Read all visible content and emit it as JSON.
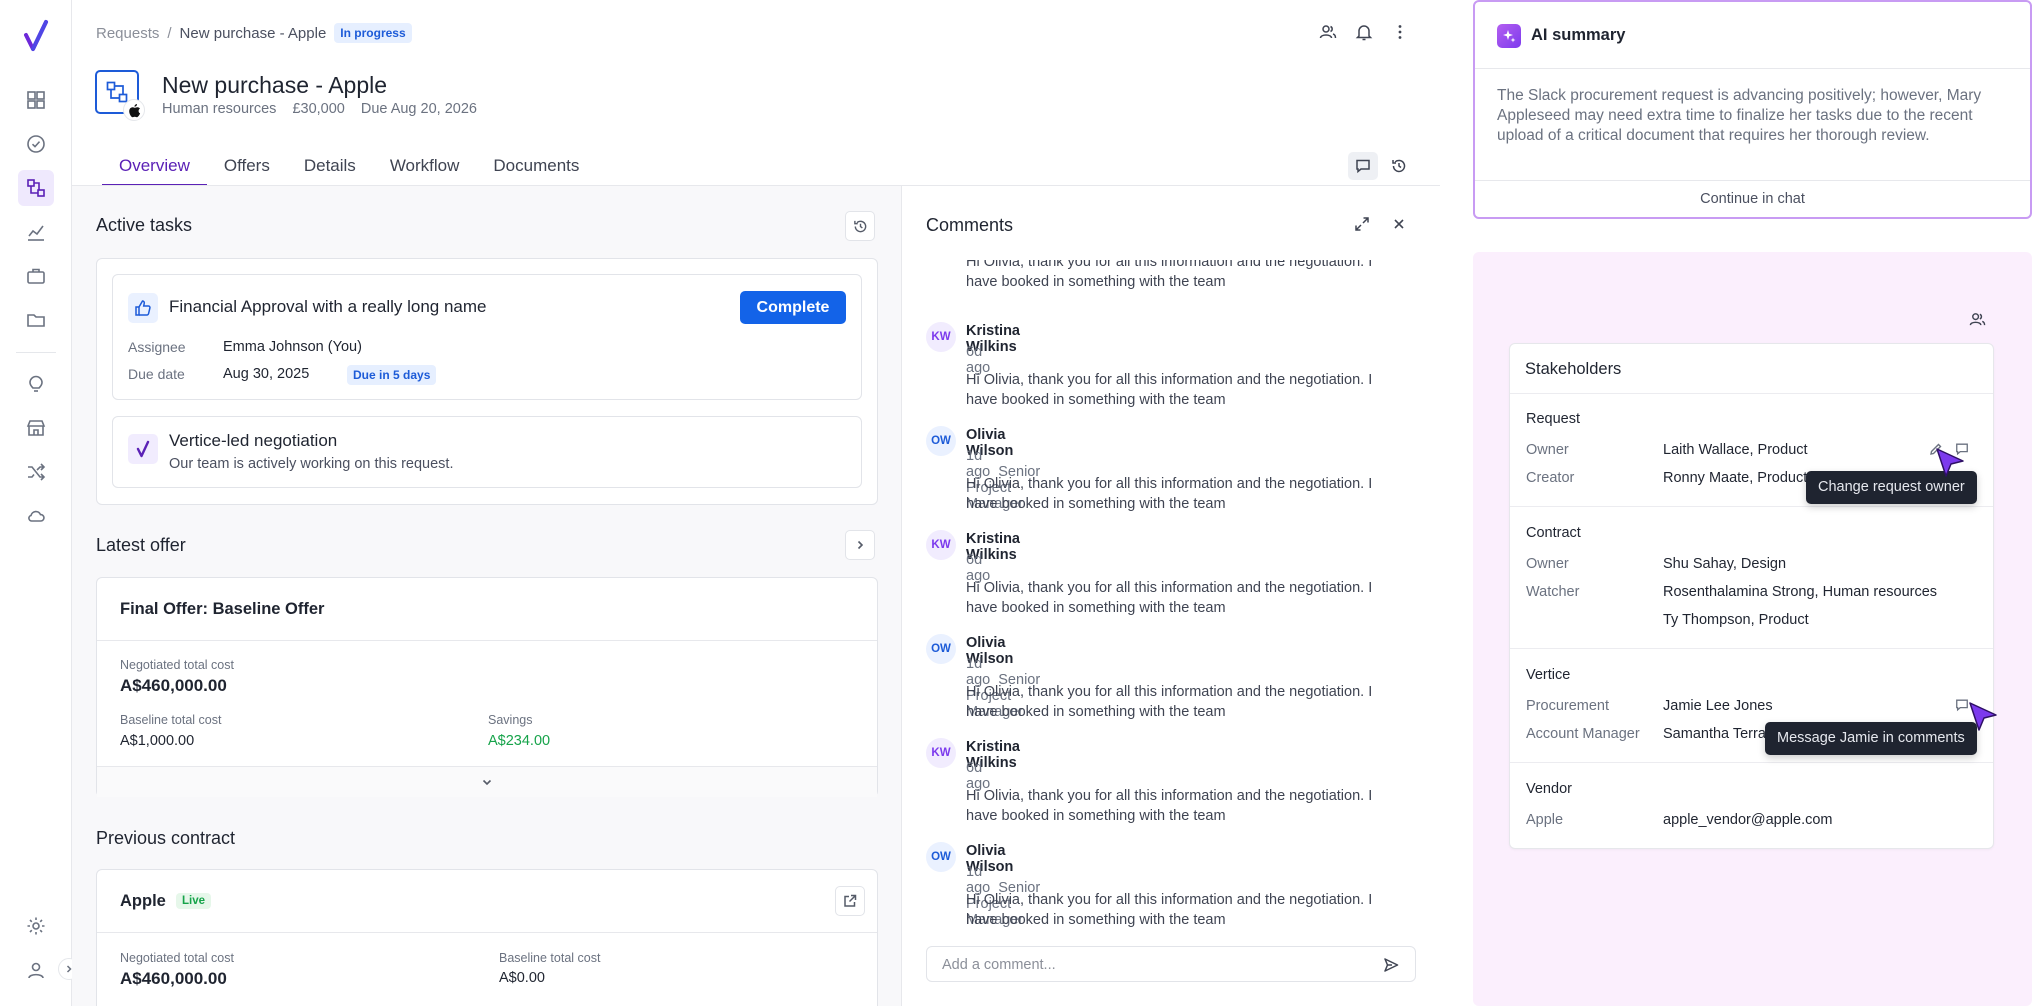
{
  "breadcrumb": {
    "parent": "Requests",
    "separator": "/",
    "current": "New purchase - Apple",
    "status": "In progress"
  },
  "header": {
    "title": "New purchase - Apple",
    "department": "Human resources",
    "amount": "£30,000",
    "due": "Due Aug 20, 2026"
  },
  "tabs": [
    "Overview",
    "Offers",
    "Details",
    "Workflow",
    "Documents"
  ],
  "active_tasks": {
    "title": "Active tasks",
    "task": {
      "name": "Financial Approval with a really long name",
      "button": "Complete",
      "assignee_label": "Assignee",
      "assignee": "Emma Johnson (You)",
      "due_label": "Due date",
      "due": "Aug 30, 2025",
      "due_badge": "Due in 5 days"
    },
    "negotiation": {
      "title": "Vertice-led negotiation",
      "subtitle": "Our team is actively working on this request."
    }
  },
  "latest_offer": {
    "title": "Latest offer",
    "offer_name": "Final Offer: Baseline Offer",
    "negotiated_label": "Negotiated total cost",
    "negotiated": "A$460,000.00",
    "baseline_label": "Baseline total cost",
    "baseline": "A$1,000.00",
    "savings_label": "Savings",
    "savings": "A$234.00"
  },
  "previous_contract": {
    "title": "Previous contract",
    "vendor": "Apple",
    "status": "Live",
    "negotiated_label": "Negotiated total cost",
    "negotiated": "A$460,000.00",
    "baseline_label": "Baseline total cost",
    "baseline": "A$0.00"
  },
  "comments": {
    "title": "Comments",
    "truncated_body": "Hi Olivia, thank you for all this information and the negotiation. I have booked in something with the team",
    "items": [
      {
        "initials": "KW",
        "name": "Kristina Wilkins",
        "time": "6d ago",
        "role": "",
        "body": "Hi Olivia, thank you for all this information and the negotiation. I have booked in something with the team"
      },
      {
        "initials": "OW",
        "name": "Olivia Wilson",
        "time": "1d ago",
        "role": "Senior Project Manager",
        "body": "Hi Olivia, thank you for all this information and the negotiation. I have booked in something with the team"
      },
      {
        "initials": "KW",
        "name": "Kristina Wilkins",
        "time": "6d ago",
        "role": "",
        "body": "Hi Olivia, thank you for all this information and the negotiation. I have booked in something with the team"
      },
      {
        "initials": "OW",
        "name": "Olivia Wilson",
        "time": "1d ago",
        "role": "Senior Project Manager",
        "body": "Hi Olivia, thank you for all this information and the negotiation. I have booked in something with the team"
      },
      {
        "initials": "KW",
        "name": "Kristina Wilkins",
        "time": "6d ago",
        "role": "",
        "body": "Hi Olivia, thank you for all this information and the negotiation. I have booked in something with the team"
      },
      {
        "initials": "OW",
        "name": "Olivia Wilson",
        "time": "1d ago",
        "role": "Senior Project Manager",
        "body": "Hi Olivia, thank you for all this information and the negotiation. I have booked in something with the team"
      }
    ],
    "placeholder": "Add a comment..."
  },
  "ai_summary": {
    "title": "AI summary",
    "body": "The Slack procurement request is advancing positively; however, Mary Appleseed may need extra time to finalize her tasks due to the recent upload of a critical document that requires her thorough review.",
    "continue": "Continue in chat"
  },
  "stakeholders": {
    "title": "Stakeholders",
    "request": {
      "title": "Request",
      "owner_label": "Owner",
      "owner": "Laith Wallace, Product",
      "creator_label": "Creator",
      "creator": "Ronny Maate, Product"
    },
    "contract": {
      "title": "Contract",
      "owner_label": "Owner",
      "owner": "Shu Sahay, Design",
      "watcher_label": "Watcher",
      "watcher1": "Rosenthalamina Strong, Human resources",
      "watcher2": "Ty Thompson, Product"
    },
    "vertice": {
      "title": "Vertice",
      "procurement_label": "Procurement",
      "procurement": "Jamie Lee Jones",
      "am_label": "Account Manager",
      "am": "Samantha Terra"
    },
    "vendor": {
      "title": "Vendor",
      "vendor_label": "Apple",
      "email": "apple_vendor@apple.com"
    },
    "tooltip_owner": "Change request owner",
    "tooltip_message": "Message Jamie in comments"
  },
  "colors": {
    "accent": "#5b21b6",
    "primary": "#1363e8",
    "savings": "#16a34a",
    "ai_border": "#c89bf3",
    "panel_bg": "#fbeffd"
  }
}
